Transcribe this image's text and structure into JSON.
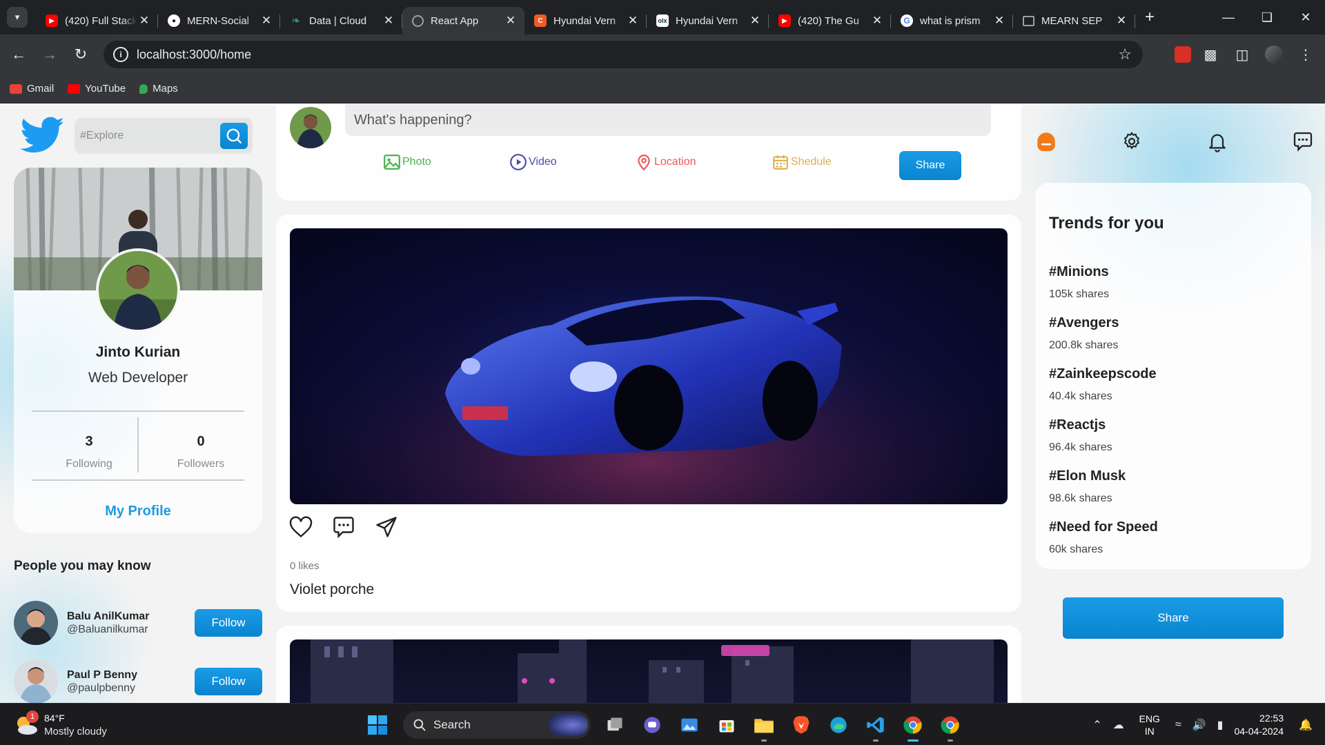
{
  "browser": {
    "tabs": [
      {
        "title": "(420) Full Stack",
        "favicon": "youtube-icon",
        "color": "#ff0000",
        "active": false
      },
      {
        "title": "MERN-Social",
        "favicon": "github-icon",
        "color": "#ffffff",
        "active": false
      },
      {
        "title": "Data | Cloud",
        "favicon": "mongodb-icon",
        "color": "#13aa52",
        "active": false
      },
      {
        "title": "React App",
        "favicon": "globe-icon",
        "color": "#9aa0a6",
        "active": true
      },
      {
        "title": "Hyundai Vern",
        "favicon": "cardekho-icon",
        "color": "#f05a28",
        "active": false
      },
      {
        "title": "Hyundai Vern",
        "favicon": "olx-icon",
        "color": "#ffffff",
        "active": false
      },
      {
        "title": "(420) The Gu",
        "favicon": "youtube-icon",
        "color": "#ff0000",
        "active": false
      },
      {
        "title": "what is prism",
        "favicon": "google-icon",
        "color": "#ffffff",
        "active": false
      },
      {
        "title": "MEARN SEP",
        "favicon": "page-icon",
        "color": "#9aa0a6",
        "active": false
      }
    ],
    "url": "localhost:3000/home",
    "bookmarks": [
      {
        "label": "Gmail",
        "icon": "gmail-icon",
        "color": "#ea4335"
      },
      {
        "label": "YouTube",
        "icon": "youtube-icon",
        "color": "#ff0000"
      },
      {
        "label": "Maps",
        "icon": "maps-icon",
        "color": "#34a853"
      }
    ]
  },
  "app": {
    "search": {
      "placeholder": "#Explore"
    },
    "profile": {
      "name": "Jinto Kurian",
      "role": "Web Developer",
      "following_count": "3",
      "following_label": "Following",
      "followers_count": "0",
      "followers_label": "Followers",
      "my_profile_label": "My Profile"
    },
    "people_title": "People you may know",
    "people": [
      {
        "name": "Balu AnilKumar",
        "handle": "@Baluanilkumar",
        "follow_label": "Follow"
      },
      {
        "name": "Paul P Benny",
        "handle": "@paulpbenny",
        "follow_label": "Follow"
      }
    ],
    "composer": {
      "placeholder": "What's happening?",
      "options": [
        {
          "label": "Photo",
          "icon": "photo-icon",
          "color": "#4caf50"
        },
        {
          "label": "Video",
          "icon": "video-icon",
          "color": "#4a4aa8"
        },
        {
          "label": "Location",
          "icon": "location-icon",
          "color": "#ef5757"
        },
        {
          "label": "Shedule",
          "icon": "calendar-icon",
          "color": "#e1ae4a"
        }
      ],
      "share_label": "Share"
    },
    "post": {
      "likes": "0 likes",
      "caption": "Violet porche"
    },
    "trends_title": "Trends for you",
    "trends": [
      {
        "tag": "#Minions",
        "shares": "105k shares"
      },
      {
        "tag": "#Avengers",
        "shares": "200.8k shares"
      },
      {
        "tag": "#Zainkeepscode",
        "shares": "40.4k shares"
      },
      {
        "tag": "#Reactjs",
        "shares": "96.4k shares"
      },
      {
        "tag": "#Elon Musk",
        "shares": "98.6k shares"
      },
      {
        "tag": "#Need for Speed",
        "shares": "60k shares"
      }
    ],
    "share_big_label": "Share",
    "accent": "#1a9be6"
  },
  "taskbar": {
    "weather": {
      "temp": "84°F",
      "condition": "Mostly cloudy",
      "badge": "1"
    },
    "search_label": "Search",
    "language": {
      "line1": "ENG",
      "line2": "IN"
    },
    "time": "22:53",
    "date": "04-04-2024"
  }
}
